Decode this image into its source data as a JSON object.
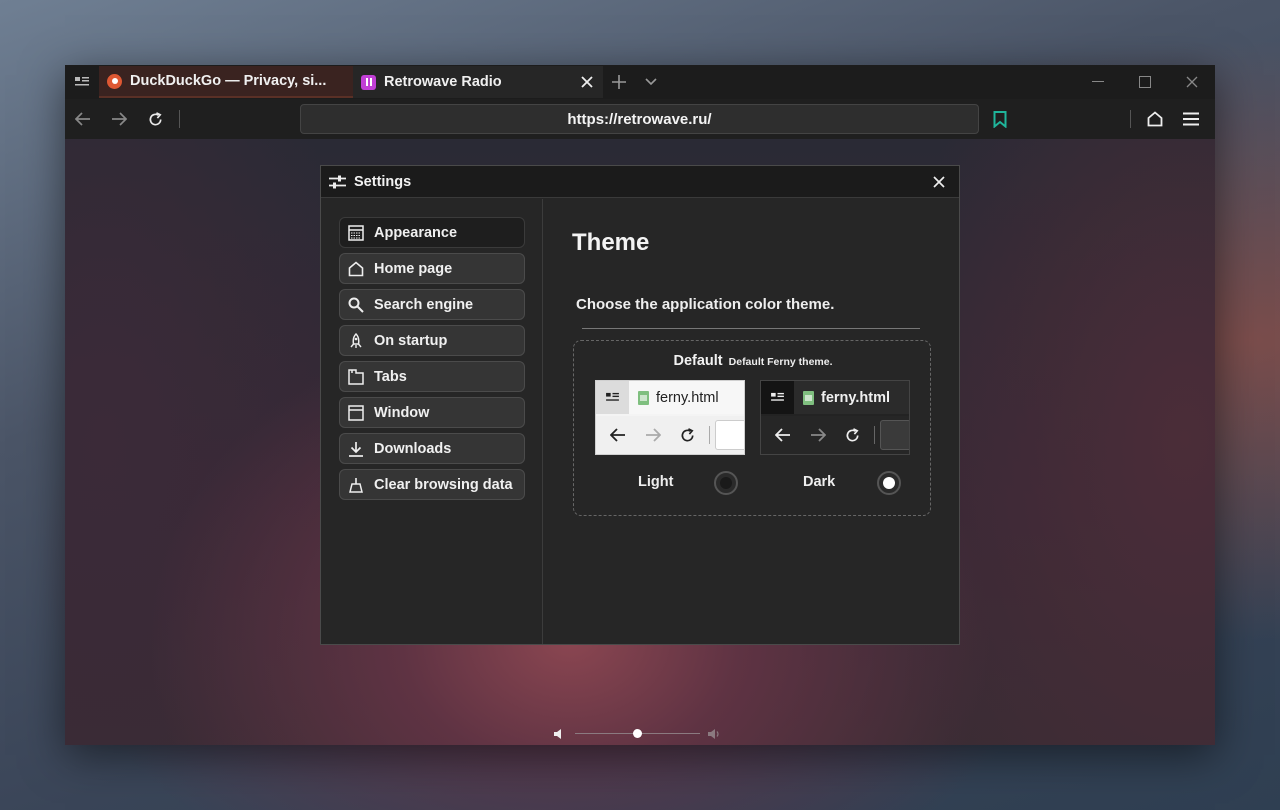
{
  "tabs": [
    {
      "title": "DuckDuckGo — Privacy, si...",
      "state": "inactive",
      "favicon": "duckduckgo-favicon"
    },
    {
      "title": "Retrowave Radio",
      "state": "active",
      "favicon": "retrowave-favicon"
    }
  ],
  "toolbar": {
    "url": "https://retrowave.ru/"
  },
  "settings": {
    "title": "Settings",
    "sidebar": [
      {
        "label": "Appearance",
        "icon": "appearance-icon",
        "selected": true
      },
      {
        "label": "Home page",
        "icon": "home-icon"
      },
      {
        "label": "Search engine",
        "icon": "search-icon"
      },
      {
        "label": "On startup",
        "icon": "rocket-icon"
      },
      {
        "label": "Tabs",
        "icon": "tabs-icon"
      },
      {
        "label": "Window",
        "icon": "window-icon"
      },
      {
        "label": "Downloads",
        "icon": "download-icon"
      },
      {
        "label": "Clear browsing data",
        "icon": "broom-icon"
      }
    ],
    "theme": {
      "heading": "Theme",
      "description": "Choose the application color theme.",
      "group_name": "Default",
      "group_subtitle": "Default Ferny theme.",
      "preview_tab_title": "ferny.html",
      "options": [
        {
          "label": "Light",
          "selected": false
        },
        {
          "label": "Dark",
          "selected": true
        }
      ]
    }
  },
  "volume": {
    "level": 0.5
  },
  "colors": {
    "bookmark_accent": "#1fb59b",
    "inactive_tab": "#3a2320"
  }
}
